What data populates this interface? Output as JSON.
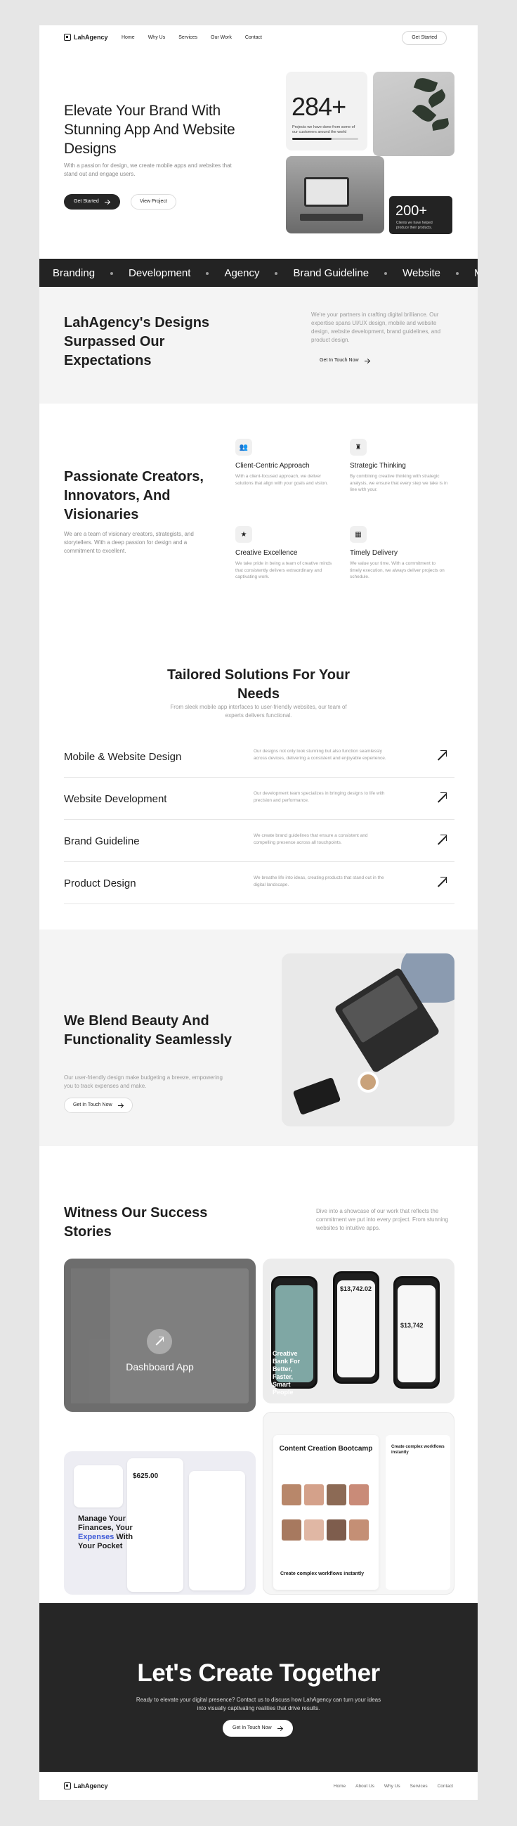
{
  "nav": {
    "brand": "LahAgency",
    "links": [
      "Home",
      "Why Us",
      "Services",
      "Our Work",
      "Contact"
    ],
    "cta": "Get Started"
  },
  "hero": {
    "title": "Elevate Your Brand With Stunning App And Website Designs",
    "subtitle": "With a passion for design, we create mobile apps and websites that stand out and engage users.",
    "primary_button": "Get Started",
    "secondary_button": "View Project",
    "stat1_value": "284+",
    "stat1_label": "Projects we have done from some of our customers around the world",
    "stat1_progress": 0.6,
    "stat2_value": "200+",
    "stat2_label": "Clients we have helped produce their products."
  },
  "ticker": [
    "Branding",
    "Development",
    "Agency",
    "Brand Guideline",
    "Website",
    "Mo"
  ],
  "surpassed": {
    "title": "LahAgency's Designs Surpassed Our Expectations",
    "text": "We're your partners in crafting digital brilliance. Our expertise spans UI/UX design, mobile and website design, website development, brand guidelines, and product design.",
    "button": "Get In Touch Now"
  },
  "passionate": {
    "title": "Passionate Creators, Innovators, And Visionaries",
    "subtitle": "We are a team of visionary creators, strategists, and storytellers. With a deep passion for design and a commitment to excellent.",
    "features": [
      {
        "icon": "users-icon",
        "title": "Client-Centric Approach",
        "text": "With a client-focused approach, we deliver solutions that align with your goals and vision."
      },
      {
        "icon": "chess-icon",
        "title": "Strategic Thinking",
        "text": "By combining creative thinking with strategic analysis, we ensure that every step we take is in line with your."
      },
      {
        "icon": "star-icon",
        "title": "Creative Excellence",
        "text": "We take pride in being a team of creative minds that consistently delivers extraordinary and captivating work."
      },
      {
        "icon": "calendar-icon",
        "title": "Timely Delivery",
        "text": "We value your time. With a commitment to timely execution, we always deliver projects on schedule."
      }
    ]
  },
  "tailored": {
    "title": "Tailored Solutions For Your Needs",
    "subtitle": "From sleek mobile app interfaces to user-friendly websites, our team of experts delivers functional.",
    "services": [
      {
        "name": "Mobile & Website Design",
        "text": "Our designs not only look stunning but also function seamlessly across devices, delivering a consistent and enjoyable experience."
      },
      {
        "name": "Website Development",
        "text": "Our development team specializes in bringing designs to life with precision and performance."
      },
      {
        "name": "Brand Guideline",
        "text": "We create brand guidelines that ensure a consistent and compelling presence across all touchpoints."
      },
      {
        "name": "Product Design",
        "text": "We breathe life into ideas, creating products that stand out in the digital landscape."
      }
    ]
  },
  "blend": {
    "title": "We Blend Beauty And Functionality Seamlessly",
    "subtitle": "Our user-friendly design make budgeting a breeze, empowering you to track expenses and make.",
    "button": "Get In Touch Now"
  },
  "stories": {
    "title": "Witness Our Success Stories",
    "subtitle": "Dive into a showcase of our work that reflects the commitment we put into every project. From stunning websites to intuitive apps.",
    "project1_label": "Dashboard App",
    "project2_text": "Creative Bank For Better, Faster, Smart People",
    "project2_amounts": [
      "$13,742.02",
      "$13,742"
    ],
    "project3_text_a": "Manage Your Finances, Your ",
    "project3_text_b": "Expenses",
    "project3_text_c": " With Your Pocket",
    "project3_amount": "$625.00",
    "project4_title": "Content Creation Bootcamp",
    "project4_caption": "Create complex workflows instantly",
    "project4_side": "Create complex workflows instantly"
  },
  "cta": {
    "title": "Let's Create Together",
    "subtitle": "Ready to elevate your digital presence? Contact us to discuss how LahAgency can turn your ideas into visually captivating realities that drive results.",
    "button": "Get In Touch Now"
  },
  "footer": {
    "brand": "LahAgency",
    "links": [
      "Home",
      "About Us",
      "Why Us",
      "Services",
      "Contact"
    ]
  },
  "colors": {
    "dark": "#262626",
    "background": "#e6e6e6",
    "muted_text": "#9a9a9a",
    "accent_blue": "#3f5bd8"
  }
}
